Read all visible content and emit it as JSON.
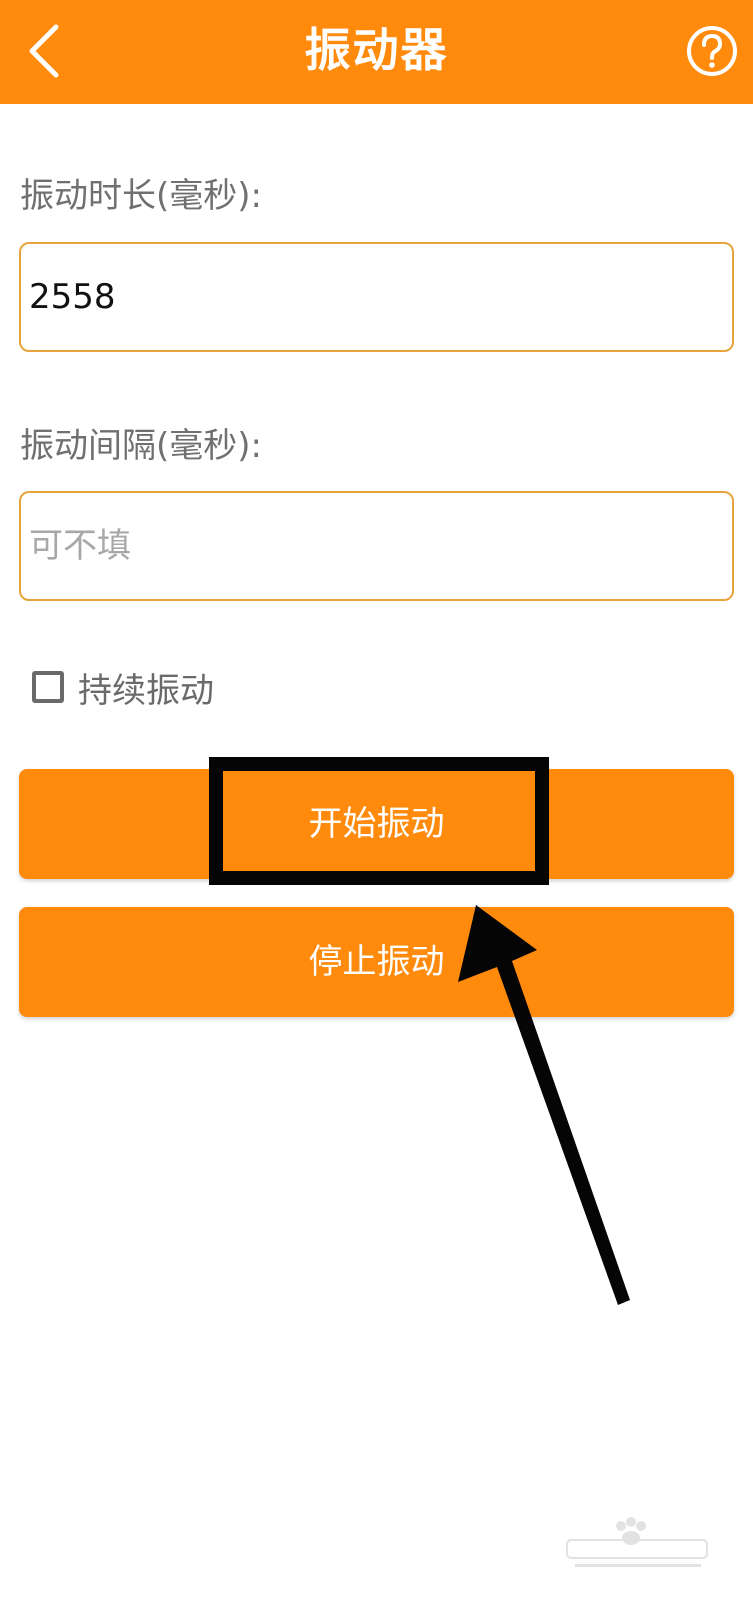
{
  "header": {
    "title": "振动器",
    "back_icon": "chevron-left-icon",
    "help_icon": "help-circle-icon"
  },
  "form": {
    "duration_label": "振动时长(毫秒):",
    "duration_value": "2558",
    "interval_label": "振动间隔(毫秒):",
    "interval_placeholder": "可不填",
    "interval_value": "",
    "continuous_label": "持续振动",
    "continuous_checked": false
  },
  "actions": {
    "start_label": "开始振动",
    "stop_label": "停止振动"
  },
  "colors": {
    "accent": "#FF8A0C",
    "input_border": "#E8A43C",
    "label_text": "#707070"
  }
}
